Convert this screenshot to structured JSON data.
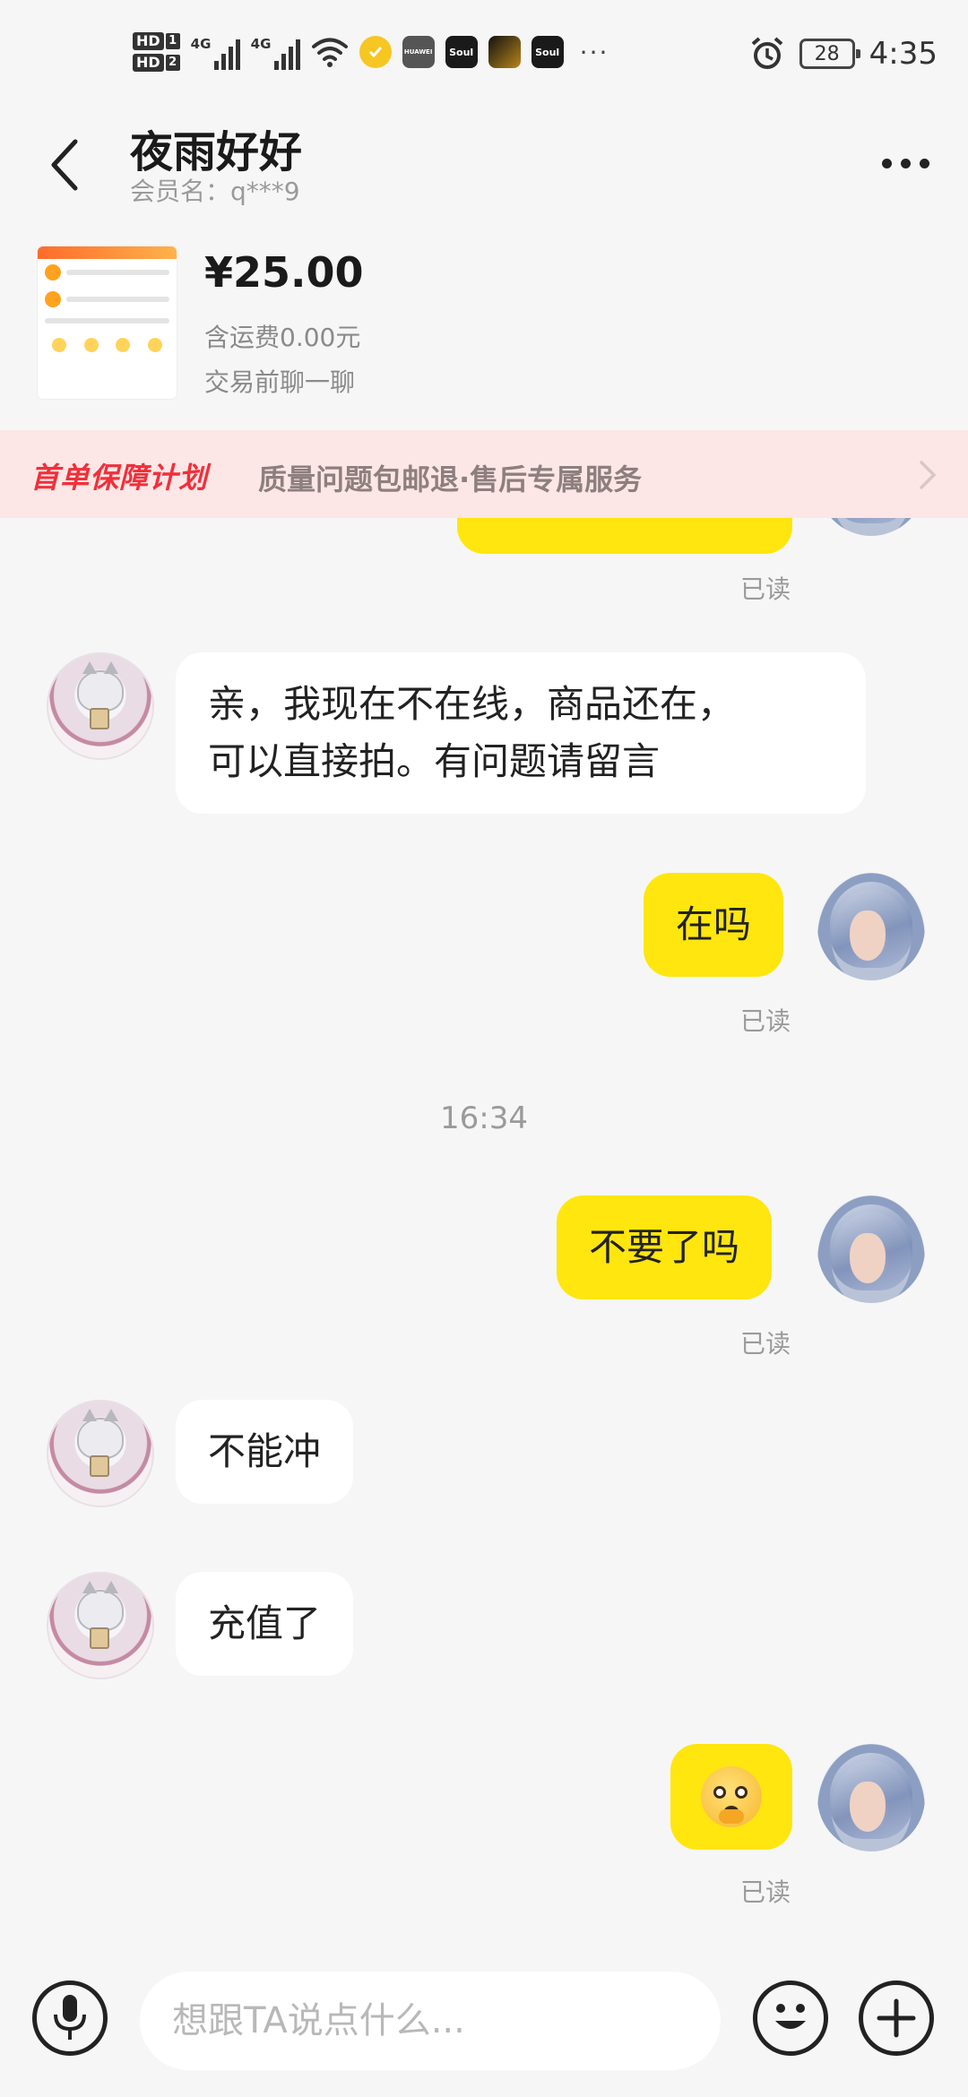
{
  "status_bar": {
    "sim1_label": "HD",
    "sim1_num": "1",
    "sim2_label": "HD",
    "sim2_num": "2",
    "net1": "4G",
    "net2": "4G",
    "app_icons": [
      "security-shield",
      "huawei",
      "soul",
      "game",
      "soul"
    ],
    "app_icon_labels": [
      "",
      "HUAWEI",
      "Soul",
      "",
      "Soul"
    ],
    "overflow": "···",
    "battery": "28",
    "time": "4:35"
  },
  "header": {
    "title": "夜雨好好",
    "subtitle": "会员名：q***9"
  },
  "product": {
    "price": "¥25.00",
    "shipping": "含运费0.00元",
    "hint": "交易前聊一聊"
  },
  "banner": {
    "title": "首单保障计划",
    "desc": "质量问题包邮退·售后专属服务"
  },
  "messages": [
    {
      "id": "m0",
      "from": "buyer",
      "text": "",
      "read": "已读"
    },
    {
      "id": "m1",
      "from": "seller",
      "text_line1": "亲，我现在不在线，商品还在，",
      "text_line2": "可以直接拍。有问题请留言"
    },
    {
      "id": "m2",
      "from": "buyer",
      "text": "在吗",
      "read": "已读"
    },
    {
      "id": "m3",
      "from": "buyer",
      "text": "不要了吗",
      "read": "已读"
    },
    {
      "id": "m4",
      "from": "seller",
      "text": "不能冲"
    },
    {
      "id": "m5",
      "from": "seller",
      "text": "充值了"
    },
    {
      "id": "m6",
      "from": "buyer",
      "emoji": "pleading-face",
      "read": "已读"
    }
  ],
  "timestamp": "16:34",
  "input": {
    "placeholder": "想跟TA说点什么..."
  },
  "colors": {
    "accent": "#ffe60f",
    "banner_bg": "#fde6e6",
    "banner_title": "#f0303a",
    "page_bg": "#f6f6f6"
  }
}
